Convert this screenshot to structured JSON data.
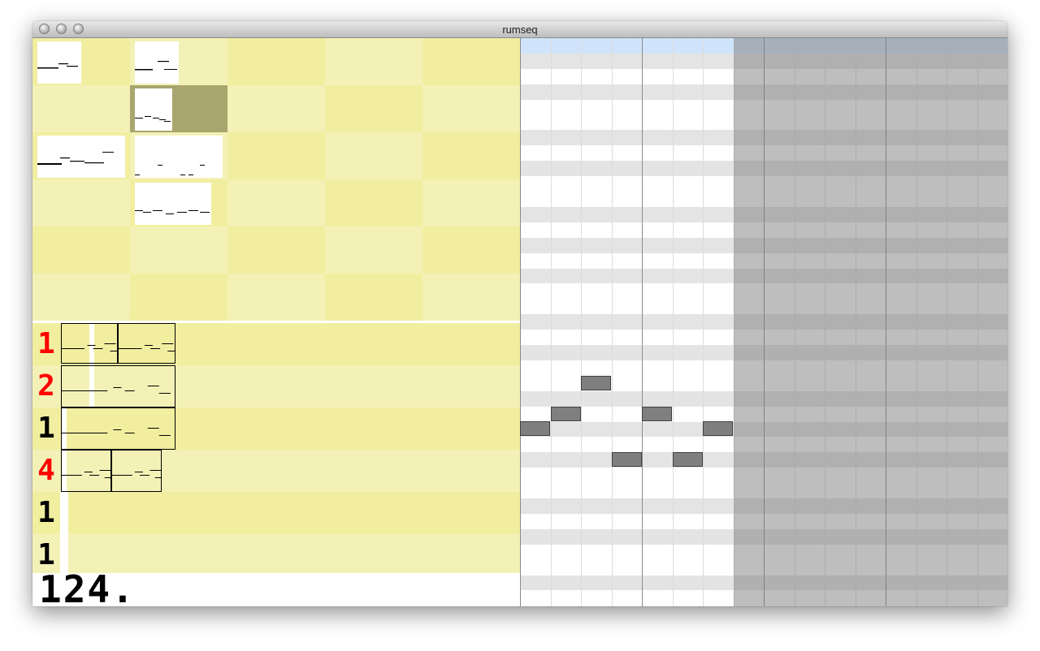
{
  "window": {
    "title": "rumseq",
    "buttons": [
      "close",
      "minimize",
      "zoom"
    ]
  },
  "colors": {
    "cell_light": "#f3f1b6",
    "cell_dark": "#f1ee9f",
    "cell_selected": "#a8a56e",
    "roll_white": "#ffffff",
    "roll_gray": "#e4e4e4",
    "roll_header": "#cfe4fa",
    "note": "#7f7f7f",
    "rep_red": "#ff0000",
    "rep_black": "#000000"
  },
  "pattern_grid": {
    "columns": 5,
    "rows": 6,
    "selected": {
      "row": 1,
      "col": 1
    },
    "patterns_present": [
      {
        "row": 0,
        "col": 0
      },
      {
        "row": 0,
        "col": 1
      },
      {
        "row": 1,
        "col": 1
      },
      {
        "row": 2,
        "col": 0
      },
      {
        "row": 2,
        "col": 1
      },
      {
        "row": 3,
        "col": 1
      }
    ]
  },
  "song": {
    "rows": [
      {
        "repeat": "1",
        "color": "red",
        "blocks": 2
      },
      {
        "repeat": "2",
        "color": "red",
        "blocks": 1
      },
      {
        "repeat": "1",
        "color": "black",
        "blocks": 1
      },
      {
        "repeat": "4",
        "color": "red",
        "blocks": 2
      },
      {
        "repeat": "1",
        "color": "black",
        "blocks": 0
      },
      {
        "repeat": "1",
        "color": "black",
        "blocks": 0
      }
    ]
  },
  "tempo": {
    "bpm_display": "124."
  },
  "piano_roll": {
    "steps_visible": 16,
    "active_steps": 7,
    "notes": [
      {
        "step": 0,
        "pitch_row": 25
      },
      {
        "step": 1,
        "pitch_row": 24
      },
      {
        "step": 2,
        "pitch_row": 22
      },
      {
        "step": 3,
        "pitch_row": 27
      },
      {
        "step": 4,
        "pitch_row": 24
      },
      {
        "step": 5,
        "pitch_row": 27
      },
      {
        "step": 6,
        "pitch_row": 25
      }
    ]
  }
}
